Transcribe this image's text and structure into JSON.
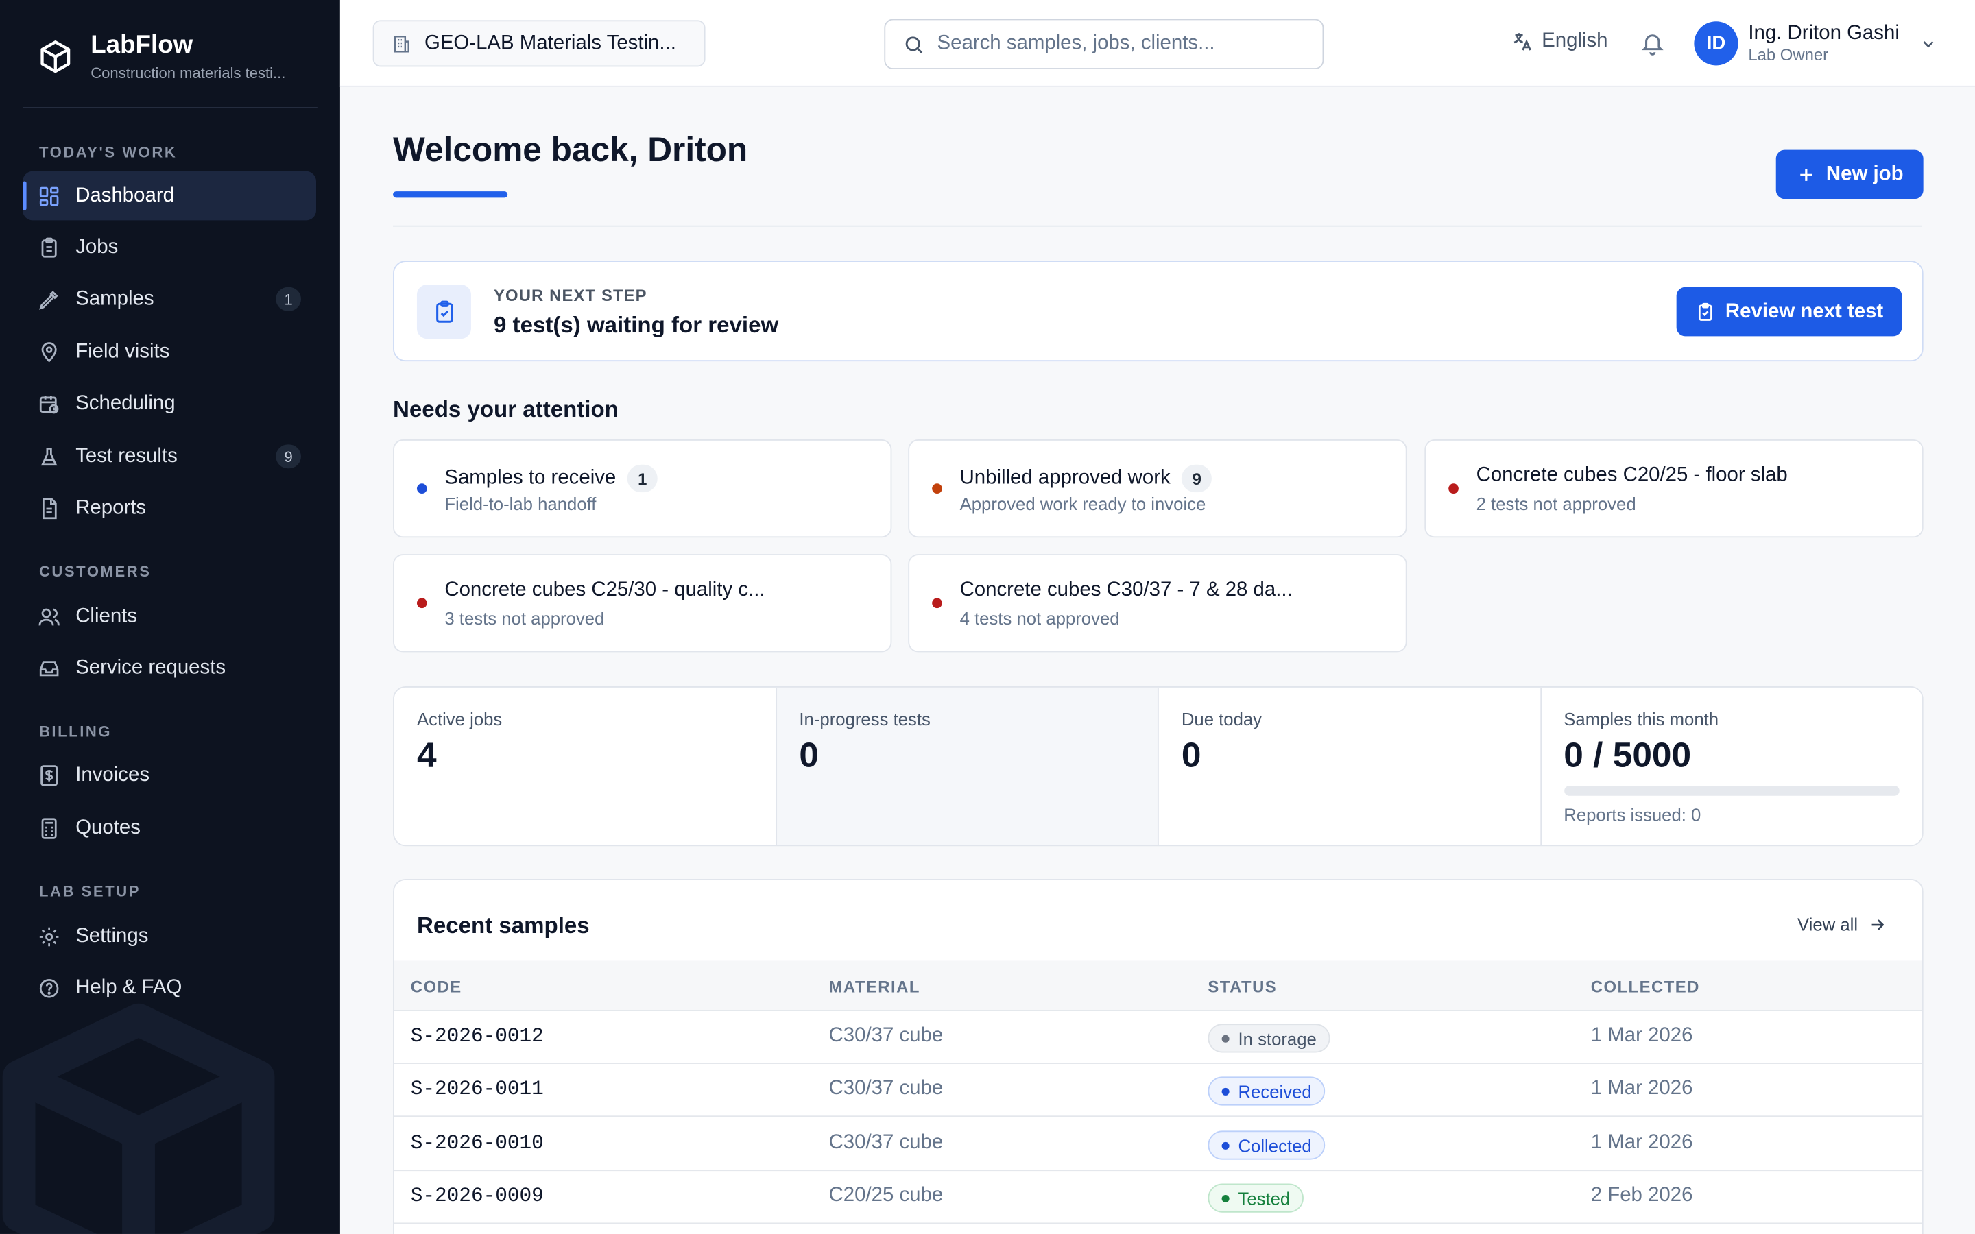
{
  "brand": {
    "name": "LabFlow",
    "tagline": "Construction materials testi..."
  },
  "sidebar": {
    "sections": [
      {
        "label": "TODAY'S WORK"
      },
      {
        "label": "CUSTOMERS"
      },
      {
        "label": "BILLING"
      },
      {
        "label": "LAB SETUP"
      }
    ],
    "items": [
      {
        "label": "Dashboard",
        "icon": "dashboard-icon",
        "active": true
      },
      {
        "label": "Jobs",
        "icon": "clipboard-icon"
      },
      {
        "label": "Samples",
        "icon": "pipette-icon",
        "count": "1"
      },
      {
        "label": "Field visits",
        "icon": "map-pin-icon"
      },
      {
        "label": "Scheduling",
        "icon": "calendar-clock-icon"
      },
      {
        "label": "Test results",
        "icon": "flask-icon",
        "count": "9"
      },
      {
        "label": "Reports",
        "icon": "document-icon"
      },
      {
        "label": "Clients",
        "icon": "users-icon"
      },
      {
        "label": "Service requests",
        "icon": "inbox-icon"
      },
      {
        "label": "Invoices",
        "icon": "receipt-icon"
      },
      {
        "label": "Quotes",
        "icon": "calculator-icon"
      },
      {
        "label": "Settings",
        "icon": "gear-icon"
      },
      {
        "label": "Help & FAQ",
        "icon": "help-circle-icon"
      }
    ]
  },
  "topbar": {
    "lab_name": "GEO-LAB Materials Testin...",
    "search_placeholder": "Search samples, jobs, clients...",
    "language": "English",
    "user": {
      "initials": "ID",
      "name": "Ing. Driton Gashi",
      "role": "Lab Owner"
    }
  },
  "main": {
    "welcome": "Welcome back, Driton",
    "new_job_label": "New job",
    "next_step": {
      "label": "YOUR NEXT STEP",
      "title": "9 test(s) waiting for review",
      "button": "Review next test"
    },
    "attention": {
      "title": "Needs your attention",
      "cards": [
        {
          "title": "Samples to receive",
          "badge": "1",
          "subtitle": "Field-to-lab handoff",
          "dot_color": "#1d4ed8"
        },
        {
          "title": "Unbilled approved work",
          "badge": "9",
          "subtitle": "Approved work ready to invoice",
          "dot_color": "#c2410c"
        },
        {
          "title": "Concrete cubes C20/25 - floor slab",
          "badge": "",
          "subtitle": "2 tests not approved",
          "dot_color": "#b91c1c"
        },
        {
          "title": "Concrete cubes C25/30 - quality c...",
          "badge": "",
          "subtitle": "3 tests not approved",
          "dot_color": "#b91c1c"
        },
        {
          "title": "Concrete cubes C30/37 - 7 & 28 da...",
          "badge": "",
          "subtitle": "4 tests not approved",
          "dot_color": "#b91c1c"
        }
      ]
    },
    "stats": [
      {
        "label": "Active jobs",
        "value": "4"
      },
      {
        "label": "In-progress tests",
        "value": "0"
      },
      {
        "label": "Due today",
        "value": "0"
      },
      {
        "label": "Samples this month",
        "value": "0 / 5000",
        "progress": 0,
        "sub": "Reports issued: 0"
      }
    ],
    "recent": {
      "title": "Recent samples",
      "view_all": "View all",
      "columns": [
        "CODE",
        "MATERIAL",
        "STATUS",
        "COLLECTED"
      ],
      "rows": [
        {
          "code": "S-2026-0012",
          "material": "C30/37 cube",
          "status": "In storage",
          "status_kind": "gray",
          "collected": "1 Mar 2026"
        },
        {
          "code": "S-2026-0011",
          "material": "C30/37 cube",
          "status": "Received",
          "status_kind": "blue",
          "collected": "1 Mar 2026"
        },
        {
          "code": "S-2026-0010",
          "material": "C30/37 cube",
          "status": "Collected",
          "status_kind": "blue",
          "collected": "1 Mar 2026"
        },
        {
          "code": "S-2026-0009",
          "material": "C20/25 cube",
          "status": "Tested",
          "status_kind": "green",
          "collected": "2 Feb 2026"
        }
      ]
    }
  },
  "colors": {
    "accent": "#1d5be6",
    "sidebar_bg": "#0d1320"
  }
}
